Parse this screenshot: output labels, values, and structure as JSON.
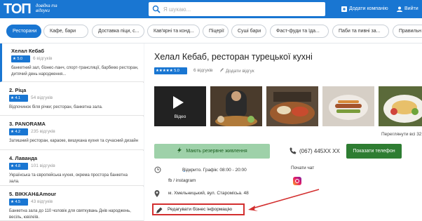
{
  "header": {
    "logo_text": "TOП",
    "logo_subtitle_line1": "довідка та",
    "logo_subtitle_line2": "відгуки",
    "search_placeholder": "Я шукаю...",
    "add_company": "Додати компанію",
    "login": "Вийти"
  },
  "categories": [
    {
      "label": "Ресторани",
      "active": true
    },
    {
      "label": "Кафе, бари"
    },
    {
      "label": "Доставка піци, с..."
    },
    {
      "label": "Кав'ярні та конд..."
    },
    {
      "label": "Піцерії"
    },
    {
      "label": "Суші бари"
    },
    {
      "label": "Фаст-фуди та їда..."
    },
    {
      "label": "Паби та пивні за..."
    },
    {
      "label": "Правильн"
    }
  ],
  "listings": [
    {
      "name": "Хелал Кебаб",
      "rating": "5.0",
      "reviews": "6 відгуків",
      "desc": "банкетний зал, бізнес-ланч, спорт-трансляції, барбекю ресторан, дитячий день народження..."
    },
    {
      "name": "2. Ріца",
      "rating": "4.1",
      "reviews": "54 відгуків",
      "desc": "Відпочинок біля річки; ресторан, банкетна зала."
    },
    {
      "name": "3. PANORAMA",
      "rating": "4.2",
      "reviews": "235 відгуків",
      "desc": "Затишний ресторан, караоке, вишукана кухня та сучасний дизайн"
    },
    {
      "name": "4. Лаванда",
      "rating": "4.8",
      "reviews": "101 відгуків",
      "desc": "Українська та європейська кухня, окрема простора банкетна зала."
    },
    {
      "name": "5. BIKKAH&Amour",
      "rating": "4.5",
      "reviews": "43 відгуків",
      "desc": "Банкетна зала до 110 чоловік для святкувань Днів народжень, весіль, ювілеїв."
    }
  ],
  "detail": {
    "title": "Хелал Кебаб, ресторан турецької кухні",
    "rating": "5.0",
    "reviews": "6 відгуків",
    "add_review": "Додати відгук",
    "video_label": "Відео",
    "view_all": "Переглянути всі 32",
    "backup_power": "Мають резервне живлення",
    "hours": "Відкрито. Графік: 08:00 - 20:00",
    "social": "fb / instagram",
    "address": "м. Хмельницький, вул. Старомісьа. 48",
    "phone": "(067) 445XX XX",
    "show_phone": "Показати телефон",
    "chat": "Почати чат",
    "edit_info": "Редагувати бізнес інформацію"
  },
  "colors": {
    "brand_blue": "#1976d2",
    "green_button": "#2e7d32",
    "highlight_red": "#d32f2f"
  }
}
